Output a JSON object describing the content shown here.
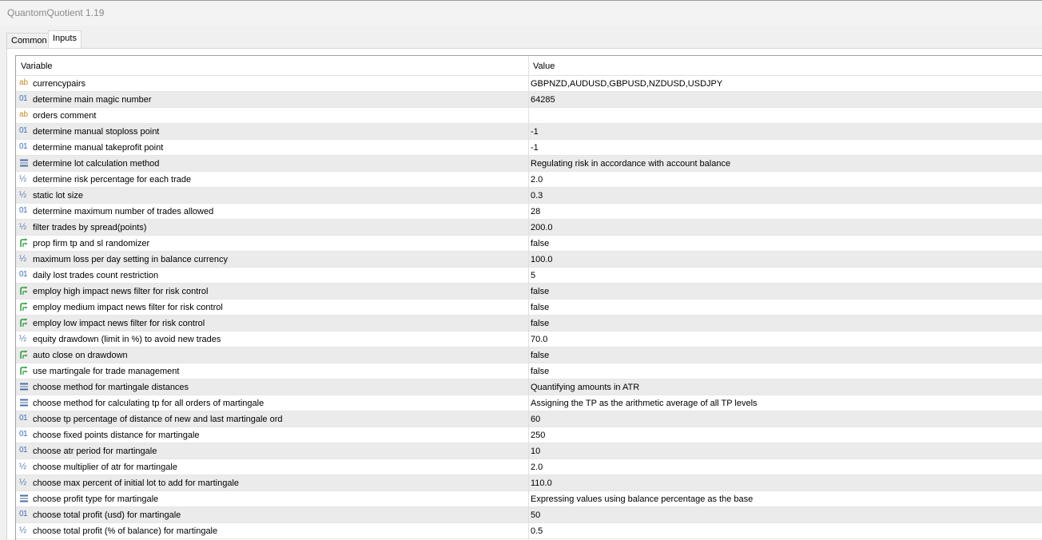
{
  "window": {
    "title": "QuantomQuotient 1.19"
  },
  "tabs": [
    {
      "label": "Common",
      "active": false
    },
    {
      "label": "Inputs",
      "active": true
    }
  ],
  "table": {
    "columns": [
      "Variable",
      "Value"
    ],
    "rows": [
      {
        "icon": "string-icon",
        "variable": "currencypairs",
        "value": "GBPNZD,AUDUSD,GBPUSD,NZDUSD,USDJPY"
      },
      {
        "icon": "integer-icon",
        "variable": "determine main magic number",
        "value": "64285"
      },
      {
        "icon": "string-icon",
        "variable": "orders comment",
        "value": ""
      },
      {
        "icon": "integer-icon",
        "variable": "determine manual stoploss point",
        "value": "-1"
      },
      {
        "icon": "integer-icon",
        "variable": "determine manual takeprofit point",
        "value": "-1"
      },
      {
        "icon": "enum-icon",
        "variable": "determine lot calculation method",
        "value": "Regulating risk in accordance with account balance"
      },
      {
        "icon": "double-icon",
        "variable": "determine risk percentage for each trade",
        "value": "2.0"
      },
      {
        "icon": "double-icon",
        "variable": "static lot size",
        "value": "0.3"
      },
      {
        "icon": "integer-icon",
        "variable": "determine maximum number of trades allowed",
        "value": "28"
      },
      {
        "icon": "double-icon",
        "variable": "filter trades by spread(points)",
        "value": "200.0"
      },
      {
        "icon": "bool-icon",
        "variable": "prop firm tp and sl randomizer",
        "value": "false"
      },
      {
        "icon": "double-icon",
        "variable": "maximum loss per day setting in balance currency",
        "value": "100.0"
      },
      {
        "icon": "integer-icon",
        "variable": "daily lost trades count restriction",
        "value": "5"
      },
      {
        "icon": "bool-icon",
        "variable": "employ high impact news filter for risk control",
        "value": "false"
      },
      {
        "icon": "bool-icon",
        "variable": "employ medium impact news filter for risk control",
        "value": "false"
      },
      {
        "icon": "bool-icon",
        "variable": "employ low impact news filter for risk control",
        "value": "false"
      },
      {
        "icon": "double-icon",
        "variable": "equity drawdown (limit in %) to avoid new trades",
        "value": "70.0"
      },
      {
        "icon": "bool-icon",
        "variable": "auto close on drawdown",
        "value": "false"
      },
      {
        "icon": "bool-icon",
        "variable": "use martingale for trade management",
        "value": "false"
      },
      {
        "icon": "enum-icon",
        "variable": "choose method for martingale distances",
        "value": "Quantifying amounts in ATR"
      },
      {
        "icon": "enum-icon",
        "variable": "choose method for calculating tp for all orders of martingale",
        "value": "Assigning the TP as the arithmetic average of all TP levels"
      },
      {
        "icon": "integer-icon",
        "variable": "choose tp percentage of distance of new and last martingale ord",
        "value": "60"
      },
      {
        "icon": "integer-icon",
        "variable": "choose fixed points distance for martingale",
        "value": "250"
      },
      {
        "icon": "integer-icon",
        "variable": "choose atr period for martingale",
        "value": "10"
      },
      {
        "icon": "double-icon",
        "variable": "choose multiplier of atr for martingale",
        "value": "2.0"
      },
      {
        "icon": "double-icon",
        "variable": "choose max percent of initial lot to add for martingale",
        "value": "110.0"
      },
      {
        "icon": "enum-icon",
        "variable": "choose profit type for martingale",
        "value": "Expressing values using balance percentage as the base"
      },
      {
        "icon": "integer-icon",
        "variable": "choose total profit (usd) for martingale",
        "value": "50"
      },
      {
        "icon": "double-icon",
        "variable": "choose total profit (% of balance) for martingale",
        "value": "0.5"
      }
    ]
  },
  "icon_glyphs": {
    "string-icon": "ab",
    "integer-icon": "01",
    "double-icon": "½"
  },
  "colors": {
    "string_icon": "#c68a2c",
    "integer_icon": "#3b6fbf",
    "bool_icon": "#2e9e3e",
    "enum_icon": "#4a6fa5",
    "alt_row": "#ebebeb"
  }
}
